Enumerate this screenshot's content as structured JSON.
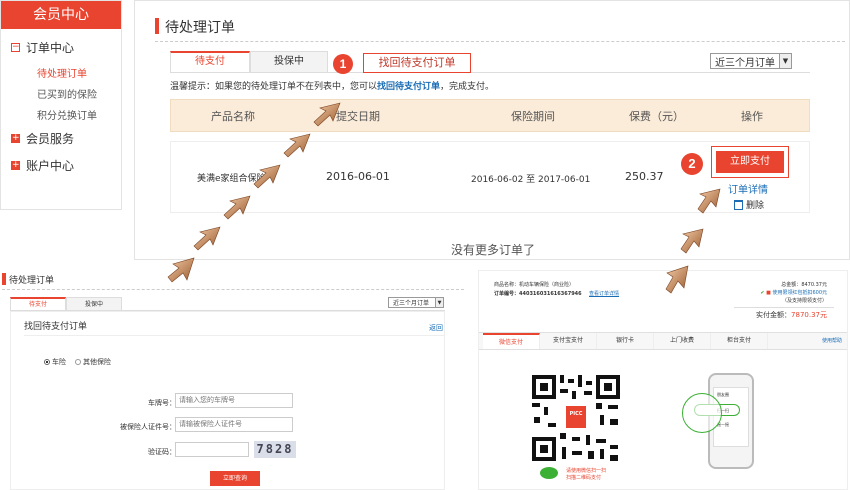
{
  "sidebar": {
    "title": "会员中心",
    "groups": [
      {
        "label": "订单中心",
        "items": [
          "待处理订单",
          "已买到的保险",
          "积分兑换订单"
        ]
      },
      {
        "label": "会员服务"
      },
      {
        "label": "账户中心"
      }
    ]
  },
  "main": {
    "title": "待处理订单",
    "tabs": [
      "待支付",
      "投保中"
    ],
    "callout1": {
      "num": "1",
      "text": "找回待支付订单"
    },
    "range_select": "近三个月订单",
    "tip_prefix": "温馨提示：如果您的待处理订单不在列表中，您可以",
    "tip_link": "找回待支付订单",
    "tip_suffix": "，完成支付。",
    "columns": [
      "产品名称",
      "提交日期",
      "保险期间",
      "保费（元）",
      "操作"
    ],
    "row": {
      "product": "美满e家组合保险",
      "date": "2016-06-01",
      "period": "2016-06-02 至 2017-06-01",
      "premium": "250.37",
      "pay_button": "立即支付",
      "detail_link": "订单详情",
      "delete_link": "删除"
    },
    "callout2": {
      "num": "2"
    },
    "no_more": "没有更多订单了"
  },
  "recover": {
    "title": "待处理订单",
    "tabs": [
      "待支付",
      "投保中"
    ],
    "range_select": "近三个月订单",
    "subtitle": "找回待支付订单",
    "back": "返回",
    "radio_car": "车险",
    "radio_other": "其他保险",
    "plate_label": "车牌号：",
    "plate_placeholder": "请输入您的车牌号",
    "id_label": "被保险人证件号：",
    "id_placeholder": "请输被保险人证件号",
    "captcha_label": "验证码：",
    "captcha_text": "7828",
    "query_button": "立即查询"
  },
  "payment": {
    "product_label": "商品名称：",
    "product_value": "机动车辆保险（商业险）",
    "order_label": "订单编号：",
    "order_value": "440316031616367946",
    "view_order": "查看订单详情",
    "total_label": "总金额：",
    "total_value": "8470.37元",
    "coupon_text": "使用限领红包抵扣600元",
    "coupon_sub": "（及支持限领支付）",
    "actual_label": "实付金额：",
    "actual_value": "7870.37元",
    "tabs": [
      "微信支付",
      "支付宝支付",
      "银行卡",
      "上门收费",
      "柜台支付"
    ],
    "help": "使用帮助",
    "qr_hint1": "请使用微信扫一扫",
    "qr_hint2": "扫描二维码支付",
    "qr_logo": "PICC",
    "phone_items": [
      "朋友圈",
      "扫一扫",
      "摇一摇"
    ]
  },
  "colors": {
    "accent": "#e8442f",
    "thead": "#fbecd9",
    "link": "#1a6db5"
  }
}
